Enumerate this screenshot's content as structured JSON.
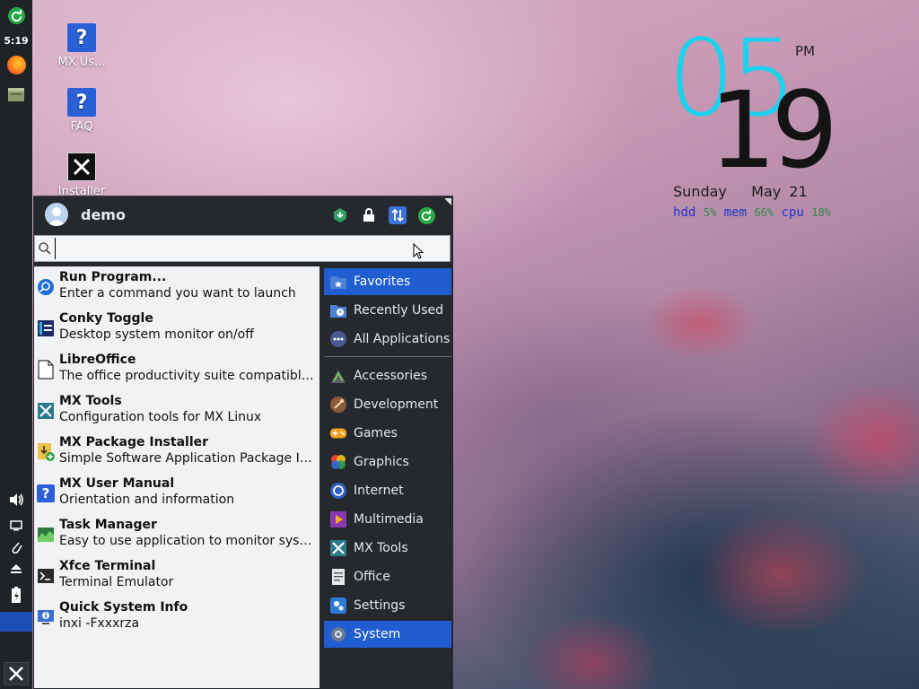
{
  "panel": {
    "clock": "5:19"
  },
  "desktop": {
    "icons": [
      {
        "label": "MX Us..."
      },
      {
        "label": "FAQ"
      },
      {
        "label": "Installer"
      }
    ]
  },
  "conky": {
    "hour": "05",
    "minute": "19",
    "ampm": "PM",
    "day": "Sunday",
    "date": "May 21",
    "stats": [
      {
        "key": "hdd",
        "value": "5%"
      },
      {
        "key": "mem",
        "value": "66%"
      },
      {
        "key": "cpu",
        "value": "18%"
      }
    ]
  },
  "menu": {
    "user": "demo",
    "search": {
      "value": "",
      "placeholder": ""
    },
    "apps": [
      {
        "title": "Run Program...",
        "desc": "Enter a command you want to launch",
        "icon": "run-program-icon"
      },
      {
        "title": "Conky Toggle",
        "desc": "Desktop system monitor on/off",
        "icon": "conky-icon"
      },
      {
        "title": "LibreOffice",
        "desc": "The office productivity suite compatible t...",
        "icon": "libreoffice-icon"
      },
      {
        "title": "MX Tools",
        "desc": "Configuration tools for MX Linux",
        "icon": "mx-tools-icon"
      },
      {
        "title": "MX Package Installer",
        "desc": "Simple Software Application Package Ins...",
        "icon": "package-installer-icon"
      },
      {
        "title": "MX User Manual",
        "desc": "Orientation and information",
        "icon": "user-manual-icon"
      },
      {
        "title": "Task Manager",
        "desc": "Easy to use application to monitor syste...",
        "icon": "task-manager-icon"
      },
      {
        "title": "Xfce Terminal",
        "desc": "Terminal Emulator",
        "icon": "terminal-icon"
      },
      {
        "title": "Quick System Info",
        "desc": "inxi -Fxxxrza",
        "icon": "system-info-icon"
      }
    ],
    "categories": [
      {
        "label": "Favorites",
        "icon": "favorites-icon",
        "active": true
      },
      {
        "label": "Recently Used",
        "icon": "recent-icon"
      },
      {
        "label": "All Applications",
        "icon": "all-apps-icon"
      },
      {
        "label": "Accessories",
        "icon": "accessories-icon"
      },
      {
        "label": "Development",
        "icon": "development-icon"
      },
      {
        "label": "Games",
        "icon": "games-icon"
      },
      {
        "label": "Graphics",
        "icon": "graphics-icon"
      },
      {
        "label": "Internet",
        "icon": "internet-icon"
      },
      {
        "label": "Multimedia",
        "icon": "multimedia-icon"
      },
      {
        "label": "MX Tools",
        "icon": "mx-tools-icon"
      },
      {
        "label": "Office",
        "icon": "office-icon"
      },
      {
        "label": "Settings",
        "icon": "settings-icon"
      },
      {
        "label": "System",
        "icon": "system-icon",
        "hover": true
      }
    ]
  },
  "colors": {
    "panel": "#1f2326",
    "menu_bg": "#25292d",
    "accent": "#1f5dd0",
    "conky_hour": "#1ad2ee"
  }
}
